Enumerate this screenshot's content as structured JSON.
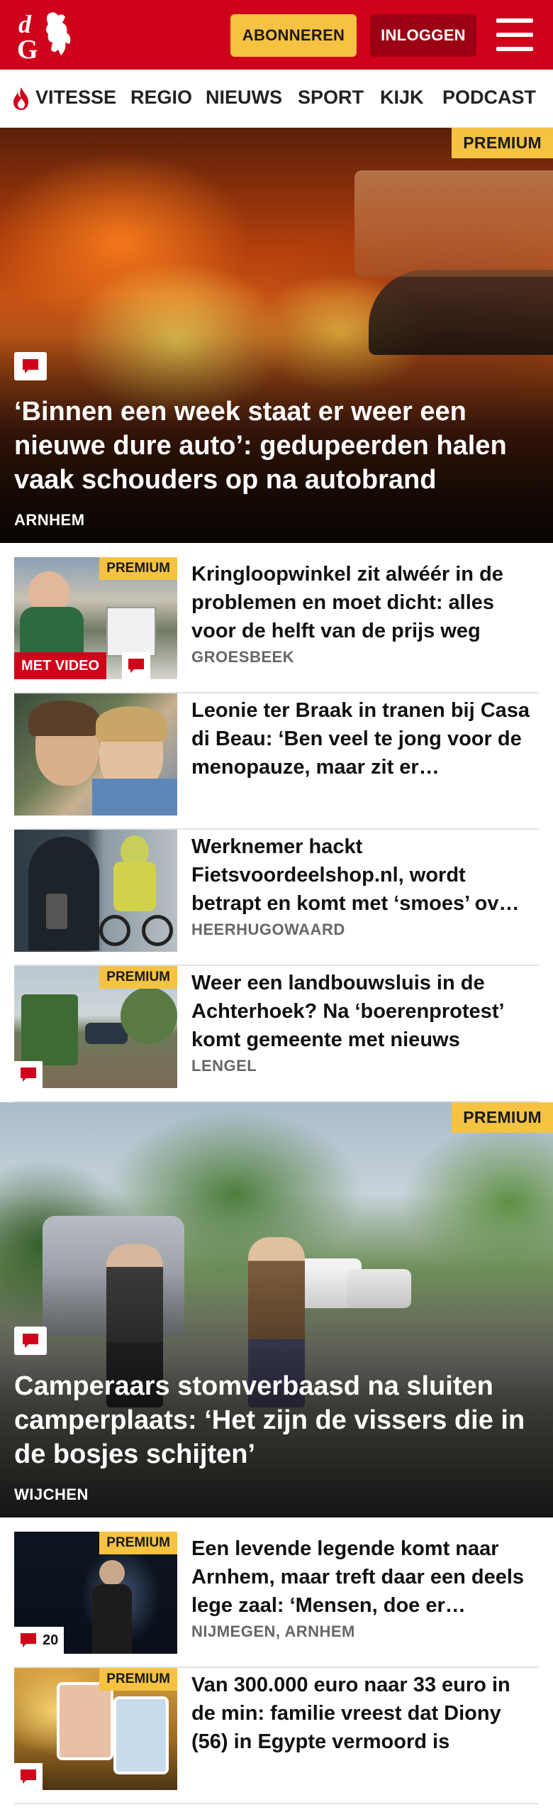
{
  "header": {
    "logo_text": "dG",
    "subscribe_label": "ABONNEREN",
    "login_label": "INLOGGEN",
    "brand_red": "#d0011b",
    "accent_yellow": "#f5c242"
  },
  "nav": {
    "items": [
      {
        "label": "VITESSE",
        "icon": "flame-icon"
      },
      {
        "label": "REGIO"
      },
      {
        "label": "NIEUWS"
      },
      {
        "label": "SPORT"
      },
      {
        "label": "KIJK"
      },
      {
        "label": "PODCAST"
      }
    ]
  },
  "hero1": {
    "badge": "PREMIUM",
    "title": "‘Binnen een week staat er weer een nieuwe dure auto’: gedupeerden halen vaak schouders op na autobrand",
    "location": "ARNHEM",
    "has_comments": true
  },
  "articles1": [
    {
      "title": "Kringloopwinkel zit alwéér in de problemen en moet dicht: alles voor de helft van de prijs weg",
      "location": "GROESBEEK",
      "badge": "PREMIUM",
      "video_label": "MET VIDEO",
      "has_comments": true
    },
    {
      "title": "Leonie ter Braak in tranen bij Casa di Beau: ‘Ben veel te jong voor de menopauze, maar zit er…",
      "location": ""
    },
    {
      "title": "Werknemer hackt Fietsvoordeelshop.nl, wordt betrapt en komt met ‘smoes’ ov…",
      "location": "HEERHUGOWAARD"
    },
    {
      "title": "Weer een landbouwsluis in de Achterhoek? Na ‘boerenprotest’ komt gemeente met nieuws",
      "location": "LENGEL",
      "badge": "PREMIUM",
      "has_comments": true
    }
  ],
  "hero2": {
    "badge": "PREMIUM",
    "title": "Camperaars stomverbaasd na sluiten camperplaats: ‘Het zijn de vissers die in de bosjes schijten’",
    "location": "WIJCHEN",
    "has_comments": true
  },
  "articles2": [
    {
      "title": "Een levende legende komt naar Arnhem, maar treft daar een deels lege zaal: ‘Mensen, doe er…",
      "location": "NIJMEGEN, ARNHEM",
      "badge": "PREMIUM",
      "comment_count": "20"
    },
    {
      "title": "Van 300.000 euro naar 33 euro in de min: familie vreest dat Diony (56) in Egypte vermoord is",
      "location": "",
      "badge": "PREMIUM",
      "has_comments": true
    }
  ]
}
